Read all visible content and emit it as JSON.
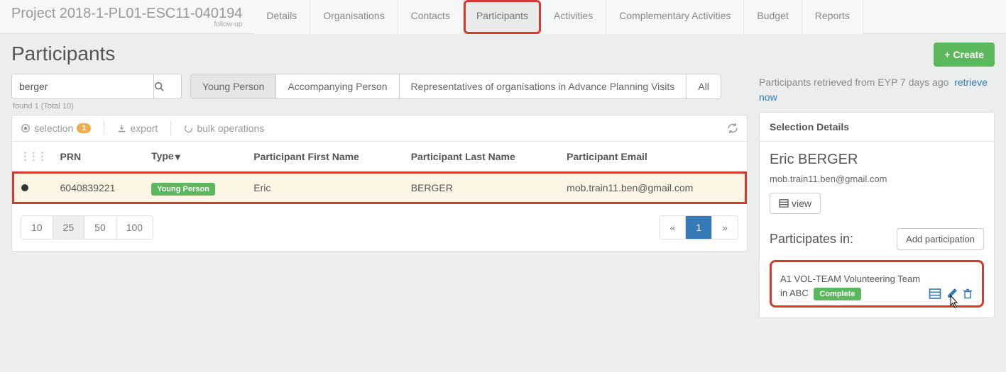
{
  "header": {
    "project_title": "Project 2018-1-PL01-ESC11-040194",
    "project_sub": "follow-up",
    "tabs": [
      "Details",
      "Organisations",
      "Contacts",
      "Participants",
      "Activities",
      "Complementary Activities",
      "Budget",
      "Reports"
    ],
    "active_tab_index": 3
  },
  "page": {
    "title": "Participants",
    "create_label": "Create"
  },
  "search": {
    "value": "berger",
    "found_text": "found 1 (Total 10)"
  },
  "filters": {
    "tabs": [
      "Young Person",
      "Accompanying Person",
      "Representatives of organisations in Advance Planning Visits",
      "All"
    ],
    "active_index": 0
  },
  "toolbar": {
    "selection_label": "selection",
    "selection_count": "1",
    "export_label": "export",
    "bulk_label": "bulk operations"
  },
  "table": {
    "columns": [
      "PRN",
      "Type",
      "Participant First Name",
      "Participant Last Name",
      "Participant Email"
    ],
    "rows": [
      {
        "prn": "6040839221",
        "type": "Young Person",
        "first": "Eric",
        "last": "BERGER",
        "email": "mob.train11.ben@gmail.com"
      }
    ]
  },
  "pager": {
    "sizes": [
      "10",
      "25",
      "50",
      "100"
    ],
    "active_size_index": 1,
    "prev": "«",
    "next": "»",
    "pages": [
      "1"
    ],
    "active_page_index": 0
  },
  "retrieve": {
    "text": "Participants retrieved from EYP 7 days ago",
    "link1": "retrieve",
    "link2": "now"
  },
  "selection_panel": {
    "title": "Selection Details",
    "name": "Eric BERGER",
    "email": "mob.train11.ben@gmail.com",
    "view_label": "view",
    "participates_title": "Participates in:",
    "add_label": "Add participation",
    "participation_text": "A1 VOL-TEAM Volunteering Team in ABC",
    "participation_status": "Complete"
  }
}
